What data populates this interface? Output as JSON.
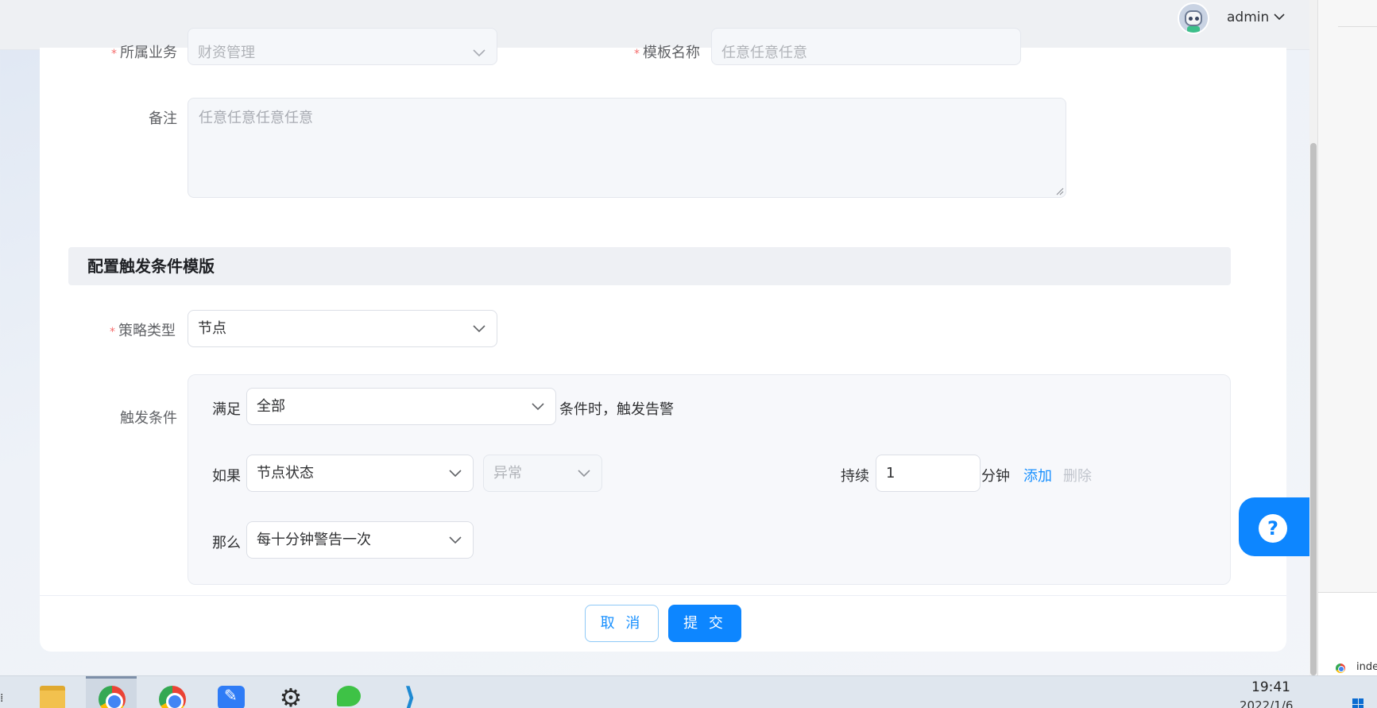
{
  "header": {
    "user_name": "admin"
  },
  "form_top": {
    "business_label": "所属业务",
    "business_value": "财资管理",
    "template_name_label": "模板名称",
    "template_name_value": "任意任意任意",
    "remark_label": "备注",
    "remark_value": "任意任意任意任意"
  },
  "section": {
    "title": "配置触发条件模版"
  },
  "strategy": {
    "label": "策略类型",
    "value": "节点"
  },
  "trigger": {
    "label": "触发条件",
    "satisfy_label": "满足",
    "satisfy_value": "全部",
    "satisfy_suffix": "条件时，触发告警",
    "if_label": "如果",
    "if_metric": "节点状态",
    "if_state": "异常",
    "duration_label": "持续",
    "duration_value": "1",
    "duration_unit": "分钟",
    "add_link": "添加",
    "delete_link": "删除",
    "then_label": "那么",
    "then_value": "每十分钟警告一次"
  },
  "footer": {
    "cancel_label": "取 消",
    "submit_label": "提 交"
  },
  "help": {
    "icon_glyph": "?"
  },
  "taskbar": {
    "time": "19:41",
    "date_partial": "2022/1/6",
    "side_tab_text": "inde",
    "apps": [
      "file-explorer-icon",
      "chrome-icon",
      "chrome-icon",
      "notes-icon",
      "settings-icon",
      "wechat-icon",
      "vscode-icon"
    ]
  },
  "colors": {
    "primary": "#0d86ff",
    "required": "#f56c6c",
    "link": "#1890ff",
    "disabled_text": "#c0c4cc"
  }
}
